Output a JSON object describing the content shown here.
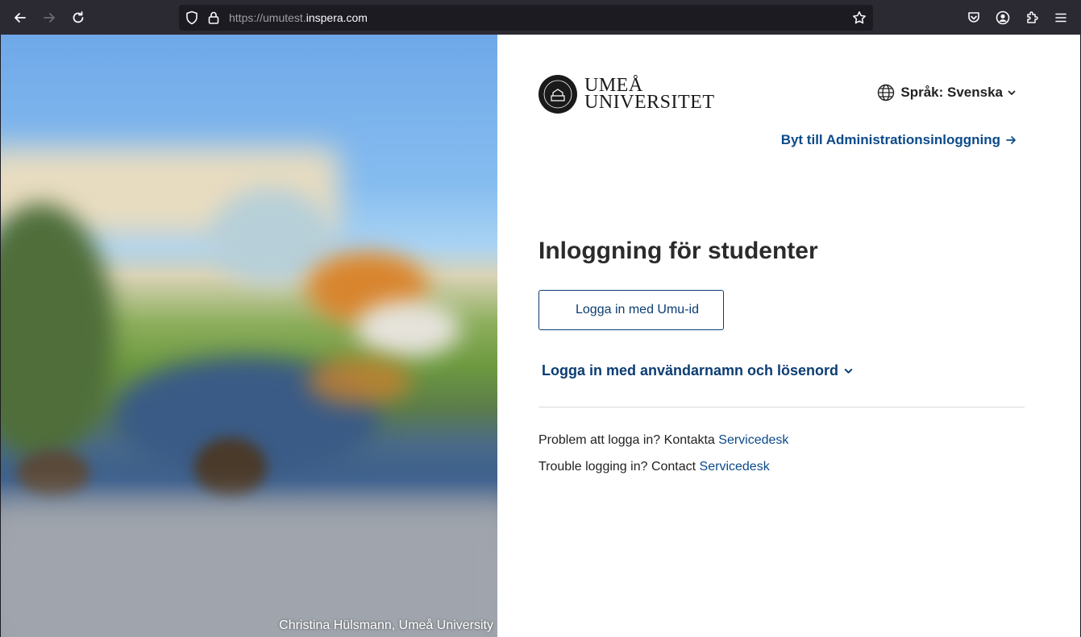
{
  "browser": {
    "url_prefix": "https://umutest.",
    "url_domain": "inspera.com"
  },
  "photo": {
    "credit": "Christina Hülsmann, Umeå University"
  },
  "logo": {
    "line1": "UMEÅ",
    "line2": "UNIVERSITET"
  },
  "language": {
    "label": "Språk: Svenska"
  },
  "admin_link": {
    "label": "Byt till Administrationsinloggning"
  },
  "login": {
    "heading": "Inloggning för studenter",
    "umu_button": "Logga in med Umu-id",
    "password_toggle": "Logga in med användarnamn och lösenord"
  },
  "help": {
    "sv_text": "Problem att logga in? Kontakta",
    "sv_link": "Servicedesk",
    "en_text": "Trouble logging in? Contact",
    "en_link": "Servicedesk"
  },
  "colors": {
    "link": "#0b4a8a",
    "button_border": "#0b3d73",
    "chrome_bg": "#2b2a33"
  }
}
